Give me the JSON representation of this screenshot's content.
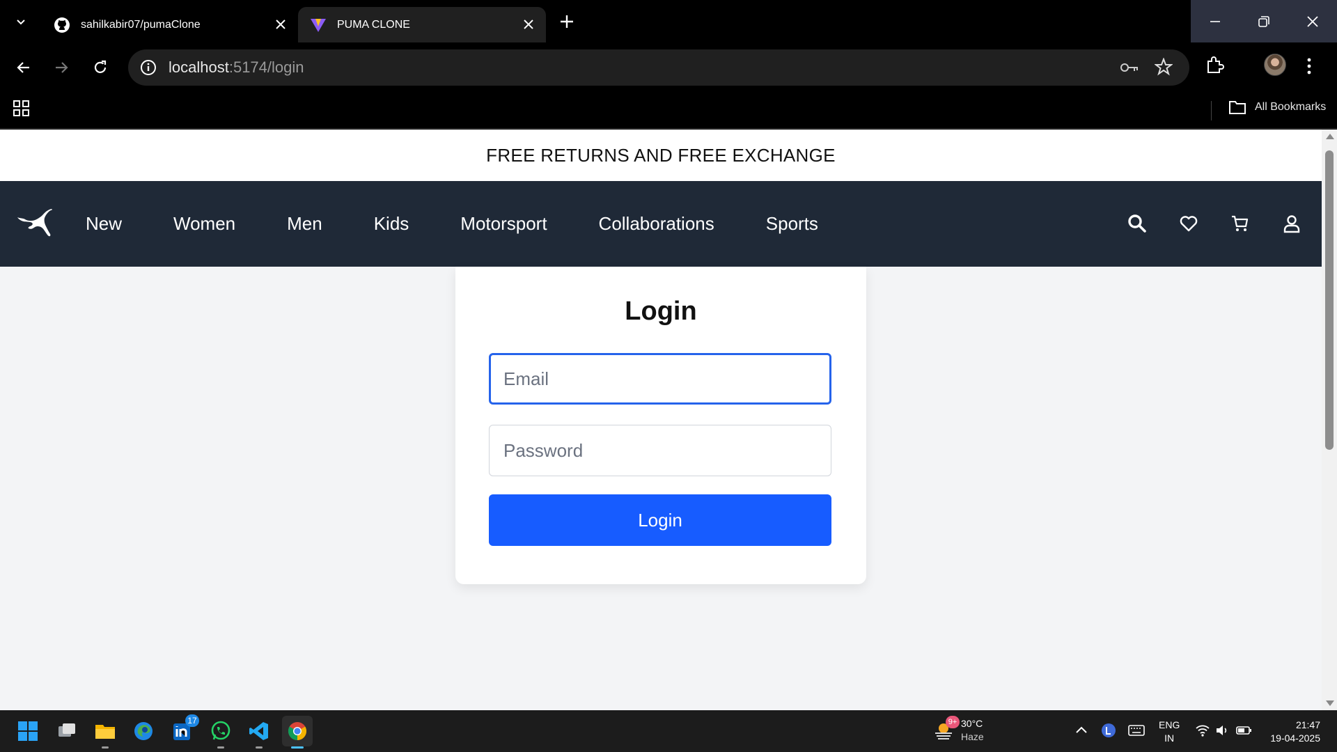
{
  "browser": {
    "tabs": [
      {
        "title": "sahilkabir07/pumaClone"
      },
      {
        "title": "PUMA CLONE"
      }
    ],
    "url_host": "localhost",
    "url_path": ":5174/login",
    "bookmarks_all": "All Bookmarks"
  },
  "site": {
    "announcement": "FREE RETURNS AND FREE EXCHANGE",
    "nav": [
      "New",
      "Women",
      "Men",
      "Kids",
      "Motorsport",
      "Collaborations",
      "Sports"
    ]
  },
  "login": {
    "title": "Login",
    "email_placeholder": "Email",
    "password_placeholder": "Password",
    "button": "Login"
  },
  "taskbar": {
    "linkedin_badge": "17",
    "weather_badge": "9+",
    "temperature": "30°C",
    "condition": "Haze",
    "lang_top": "ENG",
    "lang_bottom": "IN",
    "time": "21:47",
    "date": "19-04-2025"
  },
  "colors": {
    "navbar": "#1f2937",
    "login_button": "#175cff",
    "focus_ring": "#2563eb",
    "page_bg": "#f3f4f6"
  }
}
